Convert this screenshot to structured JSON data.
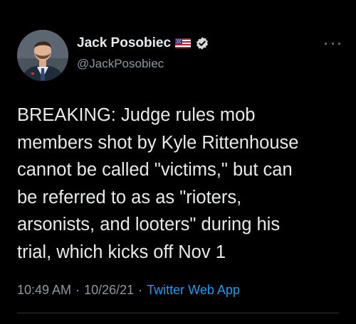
{
  "author": {
    "name": "Jack Posobiec",
    "handle": "@JackPosobiec",
    "flag_icon": "us-flag-icon",
    "verified_icon": "verified-badge-icon"
  },
  "tweet": {
    "lines": [
      "BREAKING: Judge rules mob",
      "members shot by Kyle Rittenhouse",
      "cannot be called \"victims,\" but can",
      "be referred to as as \"rioters,",
      "arsonists, and looters\" during his",
      "trial, which kicks off Nov 1"
    ]
  },
  "meta": {
    "time": "10:49 AM",
    "separator": "·",
    "date": "10/26/21",
    "source": "Twitter Web App"
  },
  "colors": {
    "background": "#000000",
    "text": "#e7e9ea",
    "secondary": "#8b98a5",
    "link": "#1d9bf0",
    "verified": "#1d9bf0"
  },
  "icons": {
    "more": "more-options-icon",
    "avatar": "profile-avatar"
  }
}
